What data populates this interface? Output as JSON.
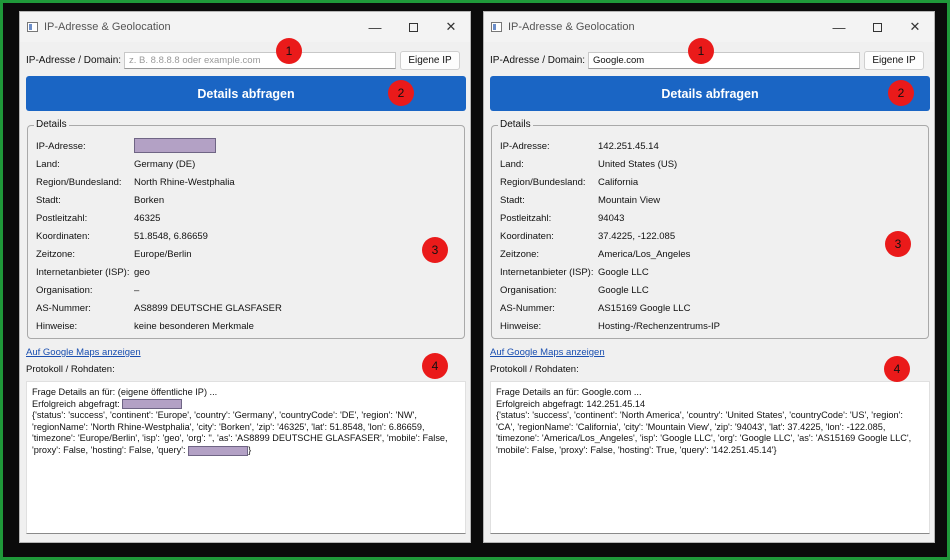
{
  "window_title": "IP-Adresse & Geolocation",
  "labels": {
    "ip_domain": "IP-Adresse / Domain:",
    "own_ip": "Eigene IP",
    "details_button": "Details abfragen",
    "group_title": "Details",
    "maps_link": "Auf Google Maps anzeigen",
    "log_label": "Protokoll / Rohdaten:",
    "fields": {
      "ip": "IP-Adresse:",
      "country": "Land:",
      "region": "Region/Bundesland:",
      "city": "Stadt:",
      "zip": "Postleitzahl:",
      "coords": "Koordinaten:",
      "timezone": "Zeitzone:",
      "isp": "Internetanbieter (ISP):",
      "org": "Organisation:",
      "as": "AS-Nummer:",
      "notes": "Hinweise:"
    }
  },
  "markers": [
    "1",
    "2",
    "3",
    "4"
  ],
  "left": {
    "input_value": "",
    "input_placeholder": "z. B. 8.8.8.8 oder example.com",
    "values": {
      "ip": "",
      "country": "Germany (DE)",
      "region": "North Rhine-Westphalia",
      "city": "Borken",
      "zip": "46325",
      "coords": "51.8548, 6.86659",
      "timezone": "Europe/Berlin",
      "isp": "geo",
      "org": "–",
      "as": "AS8899 DEUTSCHE GLASFASER",
      "notes": "keine besonderen Merkmale"
    },
    "log": {
      "line1": "Frage Details an für: (eigene öffentliche IP) ...",
      "line2_prefix": "Erfolgreich abgefragt: ",
      "json_text": "{'status': 'success', 'continent': 'Europe', 'country': 'Germany', 'countryCode': 'DE', 'region': 'NW', 'regionName': 'North Rhine-Westphalia', 'city': 'Borken', 'zip': '46325', 'lat': 51.8548, 'lon': 6.86659, 'timezone': 'Europe/Berlin', 'isp': 'geo', 'org': '', 'as': 'AS8899 DEUTSCHE GLASFASER', 'mobile': False, 'proxy': False, 'hosting': False, 'query': ",
      "json_end": "}"
    }
  },
  "right": {
    "input_value": "Google.com",
    "input_placeholder": "",
    "values": {
      "ip": "142.251.45.14",
      "country": "United States (US)",
      "region": "California",
      "city": "Mountain View",
      "zip": "94043",
      "coords": "37.4225, -122.085",
      "timezone": "America/Los_Angeles",
      "isp": "Google LLC",
      "org": "Google LLC",
      "as": "AS15169 Google LLC",
      "notes": "Hosting-/Rechenzentrums-IP"
    },
    "log": {
      "line1": "Frage Details an für: Google.com ...",
      "line2": "Erfolgreich abgefragt: 142.251.45.14",
      "json_text": "{'status': 'success', 'continent': 'North America', 'country': 'United States', 'countryCode': 'US', 'region': 'CA', 'regionName': 'California', 'city': 'Mountain View', 'zip': '94043', 'lat': 37.4225, 'lon': -122.085, 'timezone': 'America/Los_Angeles', 'isp': 'Google LLC', 'org': 'Google LLC', 'as': 'AS15169 Google LLC', 'mobile': False, 'proxy': False, 'hosting': True, 'query': '142.251.45.14'}"
    }
  },
  "colors": {
    "frame_border": "#1f9a3a",
    "primary_button": "#1a65c4",
    "marker": "#ea1a1a",
    "redaction": "#b3a1c5",
    "link": "#1a4fb0"
  }
}
